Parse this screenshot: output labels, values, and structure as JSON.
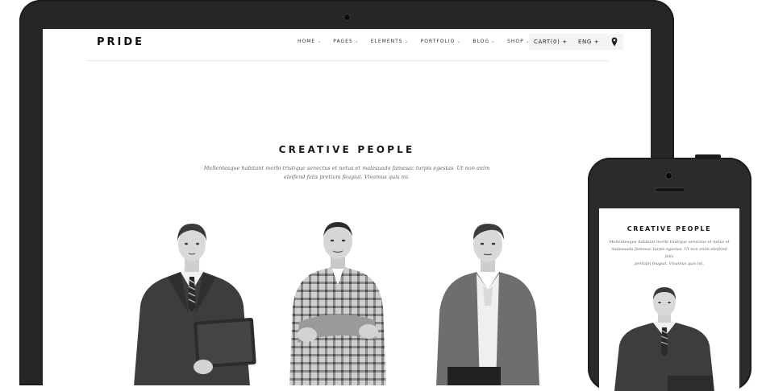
{
  "site": {
    "logo": "PRIDE",
    "nav": [
      {
        "label": "HOME",
        "chevron": "⌄"
      },
      {
        "label": "PAGES",
        "chevron": "⌄"
      },
      {
        "label": "ELEMENTS",
        "chevron": "⌄"
      },
      {
        "label": "PORTFOLIO",
        "chevron": "⌄"
      },
      {
        "label": "BLOG",
        "chevron": "⌄"
      },
      {
        "label": "SHOP",
        "chevron": "⌄"
      }
    ],
    "cart_label": "CART(0) +",
    "lang_label": "ENG +",
    "location_icon": "map-pin-icon"
  },
  "section": {
    "heading": "CREATIVE PEOPLE",
    "description_line1": "Mellentesque habitant morbi tristique senectus et netus et malesuada famesac turpis egestas. Ut non enim",
    "description_line2": "eleifend felis pretium feugiat. Vivamus quis mi.",
    "people_images": [
      "man-in-suit-with-laptop",
      "man-in-plaid-shirt-arms-crossed",
      "man-in-cardigan"
    ]
  },
  "mobile": {
    "heading": "CREATIVE PEOPLE",
    "description_line1": "Mellentesque habitant morbi tristique senectus et netus et",
    "description_line2": "malesuada famesac turpis egestas. Ut non enim eleifend felis",
    "description_line3": "pretium feugiat. Vivamus quis mi.",
    "person_image": "man-in-suit"
  },
  "colors": {
    "device_body": "#262626",
    "screen_bg": "#ffffff",
    "text_dark": "#1a1a1a"
  }
}
